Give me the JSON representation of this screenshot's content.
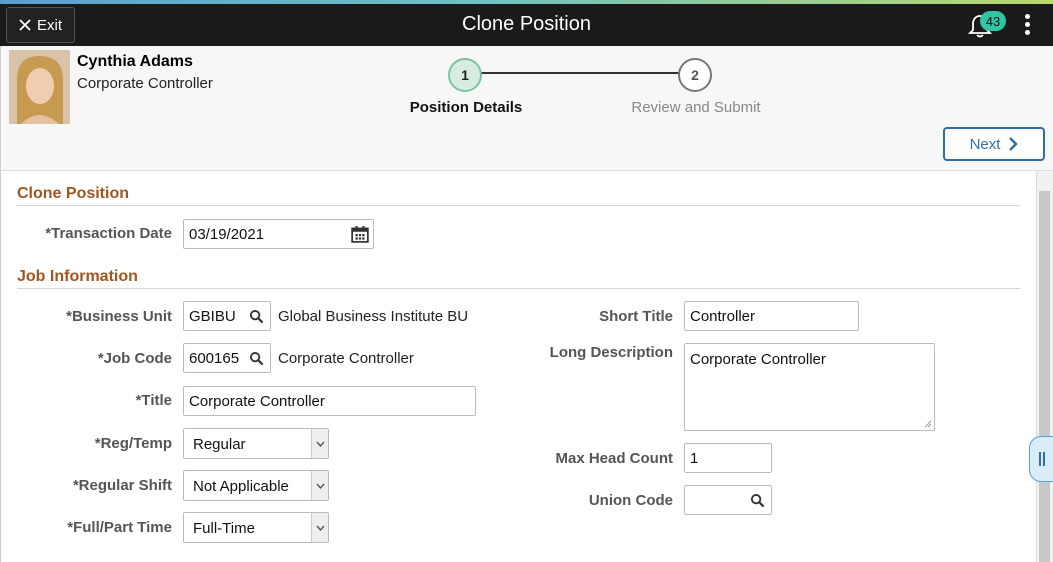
{
  "topbar": {
    "exit_label": "Exit",
    "title": "Clone Position",
    "notification_count": "43"
  },
  "person": {
    "name": "Cynthia Adams",
    "role": "Corporate Controller"
  },
  "steps": [
    {
      "number": "1",
      "label": "Position Details",
      "state": "active"
    },
    {
      "number": "2",
      "label": "Review and Submit",
      "state": "inactive"
    }
  ],
  "next_label": "Next",
  "clone_section": {
    "title": "Clone Position",
    "transaction_date_label": "*Transaction Date",
    "transaction_date": "03/19/2021"
  },
  "job_section": {
    "title": "Job Information",
    "business_unit_label": "*Business Unit",
    "business_unit": "GBIBU",
    "business_unit_desc": "Global Business Institute BU",
    "job_code_label": "*Job Code",
    "job_code": "600165",
    "job_code_desc": "Corporate Controller",
    "title_label": "*Title",
    "title_value": "Corporate Controller",
    "reg_temp_label": "*Reg/Temp",
    "reg_temp": "Regular",
    "regular_shift_label": "*Regular Shift",
    "regular_shift": "Not Applicable",
    "full_part_label": "*Full/Part Time",
    "full_part": "Full-Time",
    "short_title_label": "Short Title",
    "short_title": "Controller",
    "long_desc_label": "Long Description",
    "long_desc": "Corporate Controller",
    "max_head_label": "Max Head Count",
    "max_head": "1",
    "union_label": "Union Code",
    "union_code": ""
  },
  "colors": {
    "section_title": "#a0561e",
    "accent": "#2f6ea7",
    "badge": "#2fc6a4"
  }
}
